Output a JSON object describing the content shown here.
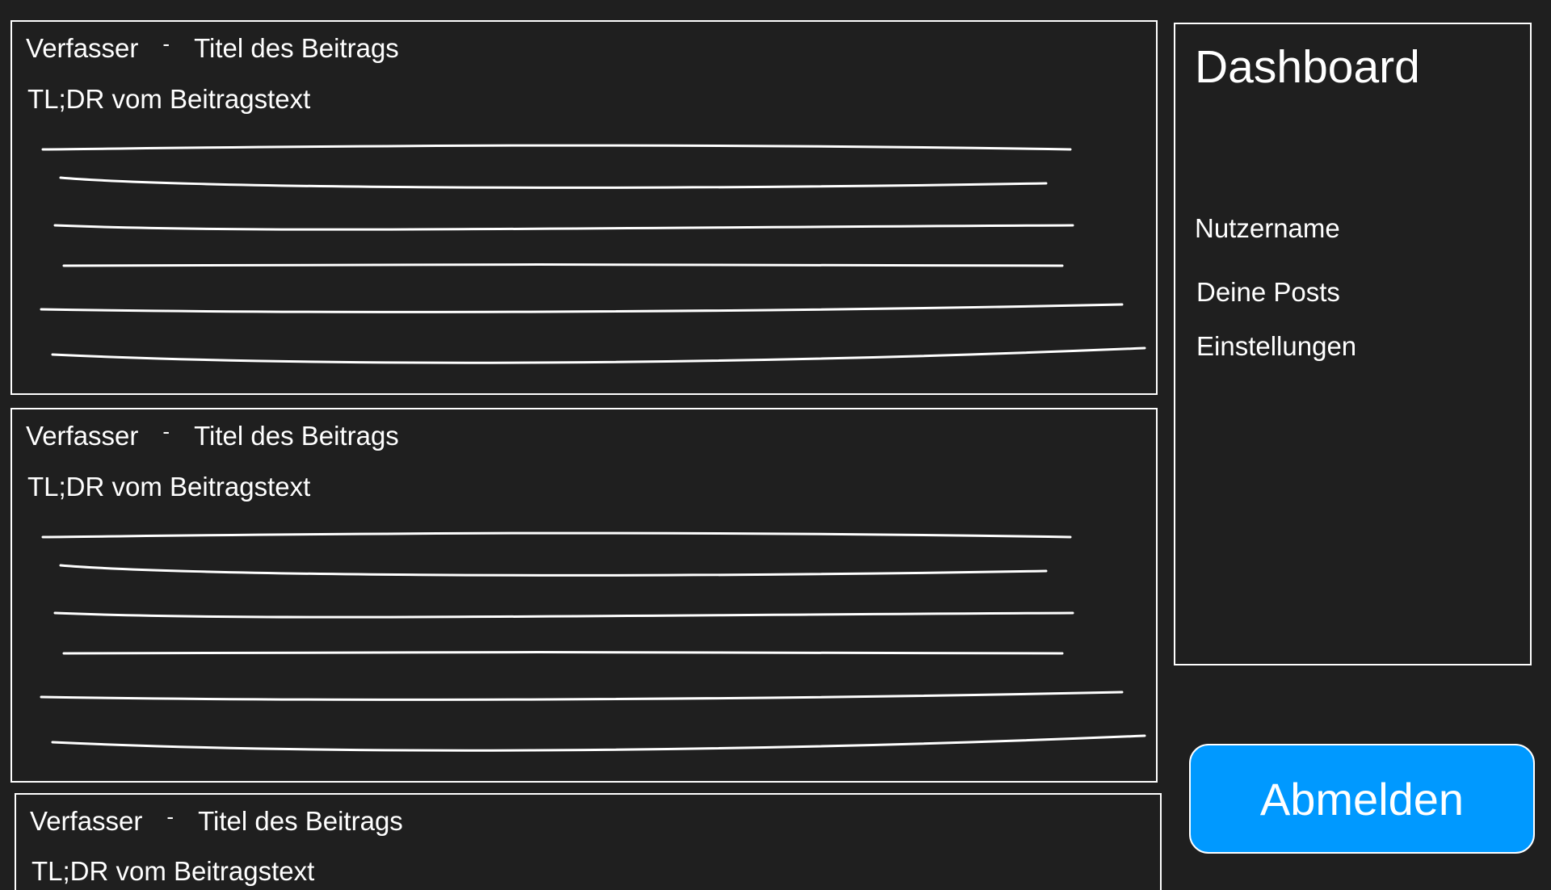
{
  "posts": [
    {
      "author": "Verfasser",
      "separator": "-",
      "title": "Titel des Beitrags",
      "tldr": "TL;DR vom Beitragstext"
    },
    {
      "author": "Verfasser",
      "separator": "-",
      "title": "Titel des Beitrags",
      "tldr": "TL;DR vom Beitragstext"
    },
    {
      "author": "Verfasser",
      "separator": "-",
      "title": "Titel des Beitrags",
      "tldr": "TL;DR vom Beitragstext"
    }
  ],
  "sidebar": {
    "title": "Dashboard",
    "username": "Nutzername",
    "links": [
      "Deine Posts",
      "Einstellungen"
    ]
  },
  "logout_button": {
    "label": "Abmelden"
  },
  "colors": {
    "background": "#1f1f1f",
    "foreground": "#ffffff",
    "accent": "#0099ff"
  }
}
